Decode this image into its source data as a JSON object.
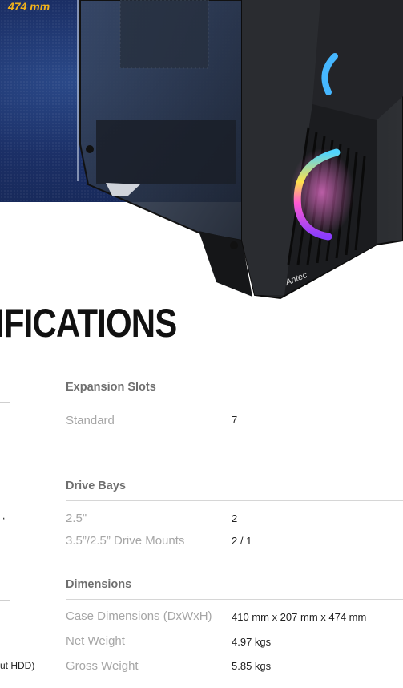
{
  "hero": {
    "height_label": "474 mm",
    "brand": "Antec"
  },
  "headline": "IFICATIONS",
  "left_fragments": {
    "comma": ",",
    "hdd": "ut HDD)"
  },
  "sections": {
    "expansion": {
      "title": "Expansion Slots",
      "rows": [
        {
          "label": "Standard",
          "value": "7"
        }
      ]
    },
    "drive_bays": {
      "title": "Drive Bays",
      "rows": [
        {
          "label": "2.5\"",
          "value": "2"
        },
        {
          "label": "3.5”/2.5” Drive Mounts",
          "value": "2 / 1"
        }
      ]
    },
    "dimensions": {
      "title": "Dimensions",
      "rows": [
        {
          "label": "Case Dimensions (DxWxH)",
          "value": "410 mm x 207 mm x 474 mm"
        },
        {
          "label": "Net Weight",
          "value": "4.97 kgs"
        },
        {
          "label": "Gross Weight",
          "value": "5.85 kgs"
        }
      ]
    }
  }
}
